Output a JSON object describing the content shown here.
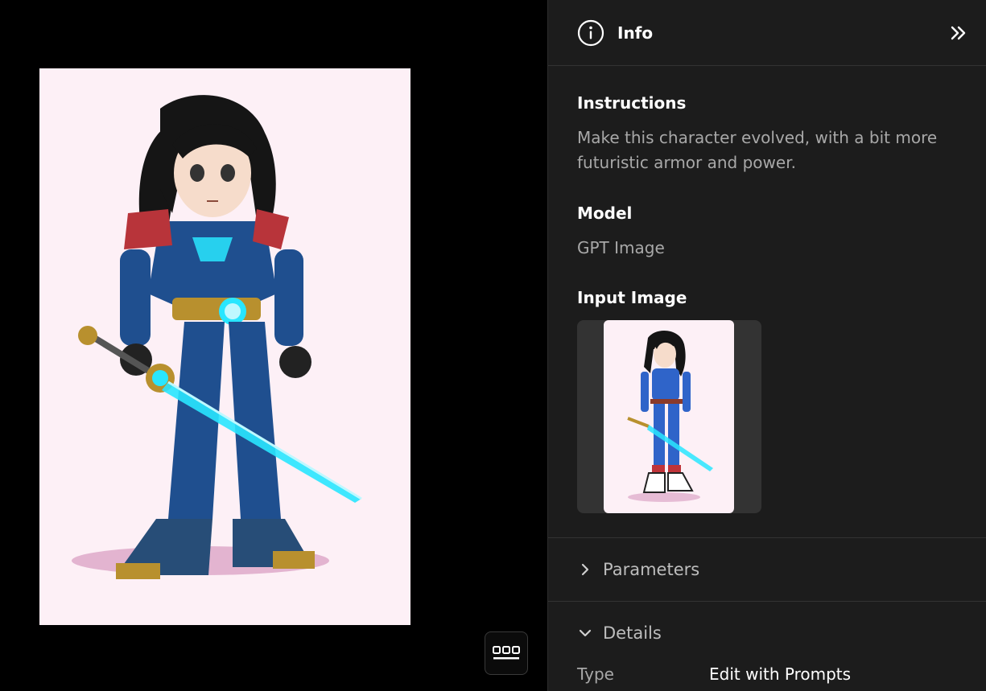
{
  "panel": {
    "title": "Info",
    "info_icon": "info-circle-icon",
    "collapse_icon": "double-chevron-right-icon"
  },
  "instructions": {
    "label": "Instructions",
    "value": "Make this character evolved, with a bit more futuristic armor and power."
  },
  "model": {
    "label": "Model",
    "value": "GPT Image"
  },
  "input_image": {
    "label": "Input Image"
  },
  "parameters": {
    "label": "Parameters",
    "icon": "chevron-right-icon"
  },
  "details": {
    "label": "Details",
    "icon": "chevron-down-icon",
    "rows": [
      {
        "key": "Type",
        "value": "Edit with Prompts"
      }
    ]
  },
  "viewer": {
    "strip_icon": "thumbnail-strip-icon"
  },
  "colors": {
    "panel_bg": "#1c1c1c",
    "viewer_bg": "#000000",
    "image_bg": "#fdf0f6",
    "muted_text": "#a8a8a8",
    "accent_glow": "#29e6ff",
    "armor_blue": "#1f4f8f"
  }
}
